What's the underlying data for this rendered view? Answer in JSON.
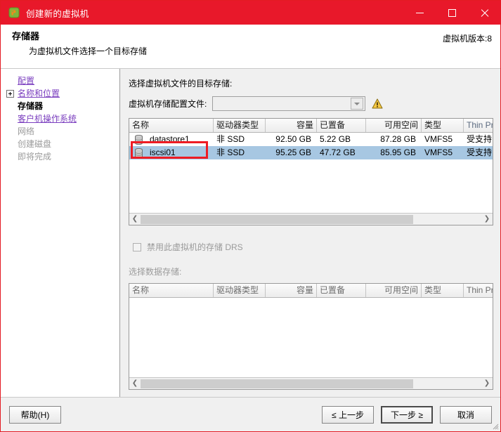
{
  "window": {
    "title": "创建新的虚拟机",
    "icon": "vmware-vm-icon",
    "controls": {
      "minimize": "minimize-icon",
      "maximize": "maximize-icon",
      "close": "close-icon"
    }
  },
  "header": {
    "title": "存储器",
    "subtitle": "为虚拟机文件选择一个目标存储",
    "version_label": "虚拟机版本:",
    "version_value": "8"
  },
  "sidebar": {
    "items": [
      {
        "label": "配置",
        "state": "link",
        "expander": false
      },
      {
        "label": "名称和位置",
        "state": "link",
        "expander": true
      },
      {
        "label": "存储器",
        "state": "current",
        "expander": false
      },
      {
        "label": "客户机操作系统",
        "state": "link",
        "expander": false
      },
      {
        "label": "网络",
        "state": "disabled",
        "expander": false
      },
      {
        "label": "创建磁盘",
        "state": "disabled",
        "expander": false
      },
      {
        "label": "即将完成",
        "state": "disabled",
        "expander": false
      }
    ]
  },
  "main": {
    "prompt": "选择虚拟机文件的目标存储:",
    "profile": {
      "label": "虚拟机存储配置文件:",
      "value": "",
      "placeholder": "",
      "warning_icon": "warning-triangle-icon"
    },
    "datastore_table": {
      "columns": [
        "名称",
        "驱动器类型",
        "容量",
        "已置备",
        "可用空间",
        "类型",
        "Thin Provi"
      ],
      "rows": [
        {
          "name": "datastore1",
          "drive_type": "非 SSD",
          "capacity": "92.50 GB",
          "provisioned": "5.22 GB",
          "free": "87.28 GB",
          "type": "VMFS5",
          "thin": "受支持",
          "selected": false,
          "highlighted": false
        },
        {
          "name": "iscsi01",
          "drive_type": "非 SSD",
          "capacity": "95.25 GB",
          "provisioned": "47.72 GB",
          "free": "85.95 GB",
          "type": "VMFS5",
          "thin": "受支持",
          "selected": true,
          "highlighted": true
        }
      ]
    },
    "drs": {
      "checkbox_label": "禁用此虚拟机的存储 DRS",
      "checked": false,
      "enabled": false
    },
    "select_datastore_label": "选择数据存储:",
    "second_table": {
      "columns": [
        "名称",
        "驱动器类型",
        "容量",
        "已置备",
        "可用空间",
        "类型",
        "Thin Provi"
      ],
      "rows": []
    }
  },
  "footer": {
    "help": "帮助(H)",
    "help_mnemonic": "H",
    "back": "≤ 上一步",
    "next": "下一步 ≥",
    "cancel": "取消"
  },
  "colors": {
    "titlebar": "#e8182a",
    "selection": "#a7c7e2",
    "link": "#7b3fbf",
    "annotation": "#ee1c24",
    "warning": "#f2c230"
  }
}
